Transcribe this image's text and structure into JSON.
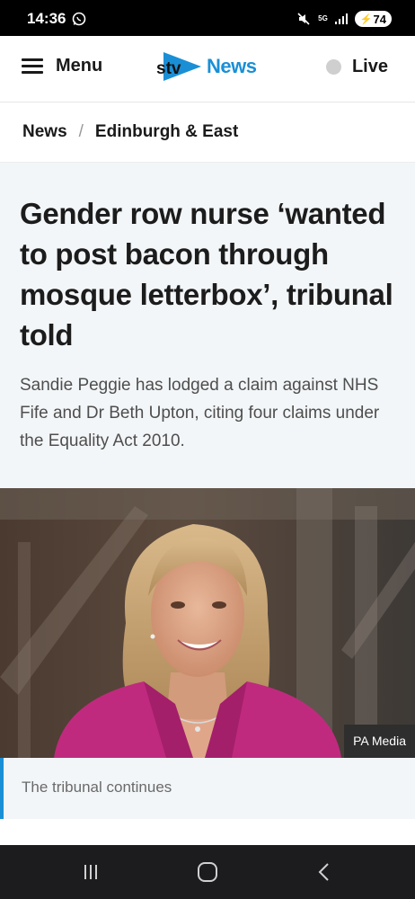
{
  "status_bar": {
    "time": "14:36",
    "network": "5G",
    "battery": "74"
  },
  "nav": {
    "menu_label": "Menu",
    "logo_brand": "stv",
    "logo_section": "News",
    "live_label": "Live"
  },
  "breadcrumb": {
    "items": [
      "News",
      "Edinburgh & East"
    ],
    "separator": "/"
  },
  "article": {
    "headline": "Gender row nurse ‘wanted to post bacon through mosque letterbox’, tribunal told",
    "standfirst": "Sandie Peggie has lodged a claim against NHS Fife and Dr Beth Upton, citing four claims under the Equality Act 2010.",
    "image_credit": "PA Media",
    "image_caption": "The tribunal continues"
  },
  "colors": {
    "accent": "#1a8fd6",
    "jacket": "#c02a7e"
  }
}
